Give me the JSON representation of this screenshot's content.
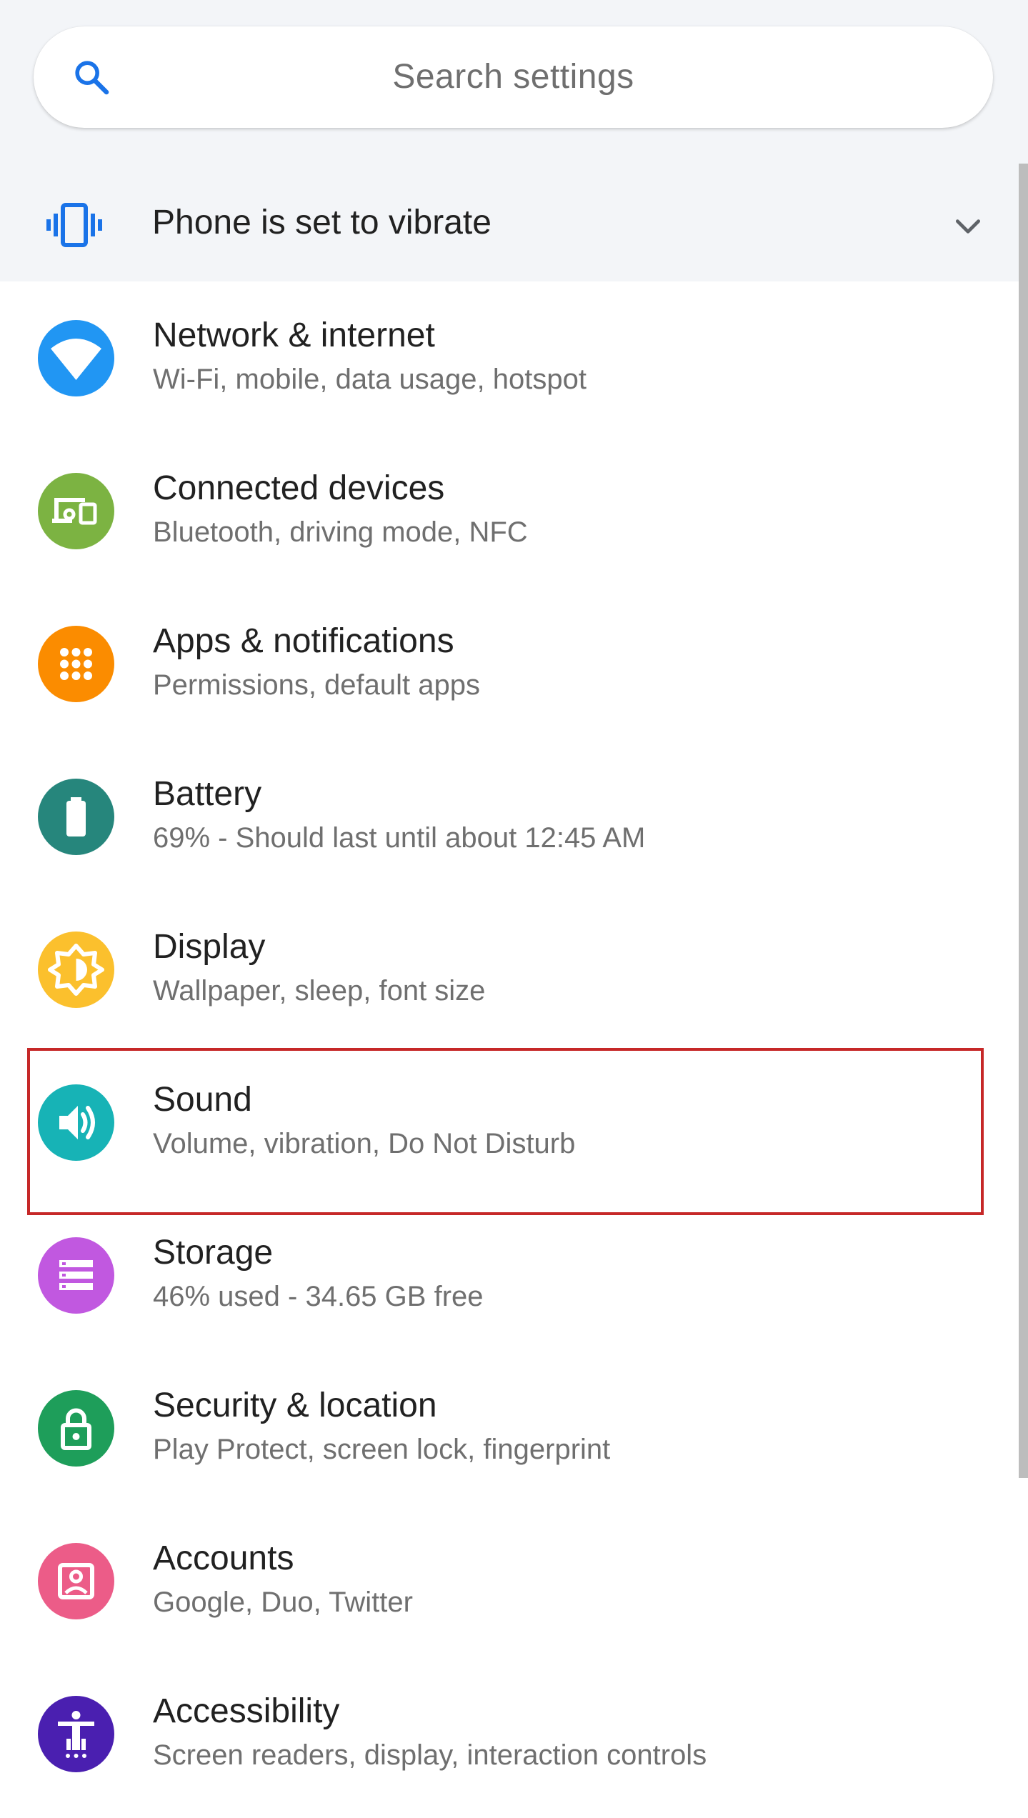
{
  "search": {
    "placeholder": "Search settings",
    "icon": "search-icon"
  },
  "status": {
    "text": "Phone is set to vibrate",
    "icon": "vibrate-icon",
    "expand_icon": "chevron-down-icon"
  },
  "colors": {
    "accent": "#1a73e8",
    "highlight_border": "#c62828"
  },
  "items": [
    {
      "title": "Network & internet",
      "subtitle": "Wi-Fi, mobile, data usage, hotspot",
      "icon": "wifi-icon",
      "color": "#2196f3"
    },
    {
      "title": "Connected devices",
      "subtitle": "Bluetooth, driving mode, NFC",
      "icon": "devices-icon",
      "color": "#7cb342"
    },
    {
      "title": "Apps & notifications",
      "subtitle": "Permissions, default apps",
      "icon": "apps-grid-icon",
      "color": "#fb8c00"
    },
    {
      "title": "Battery",
      "subtitle": "69% - Should last until about 12:45 AM",
      "icon": "battery-icon",
      "color": "#26867c"
    },
    {
      "title": "Display",
      "subtitle": "Wallpaper, sleep, font size",
      "icon": "brightness-icon",
      "color": "#fbc02d"
    },
    {
      "title": "Sound",
      "subtitle": "Volume, vibration, Do Not Disturb",
      "icon": "speaker-icon",
      "color": "#17b3b6"
    },
    {
      "title": "Storage",
      "subtitle": "46% used - 34.65 GB free",
      "icon": "storage-icon",
      "color": "#c158e0"
    },
    {
      "title": "Security & location",
      "subtitle": "Play Protect, screen lock, fingerprint",
      "icon": "lock-icon",
      "color": "#1e9e5a"
    },
    {
      "title": "Accounts",
      "subtitle": "Google, Duo, Twitter",
      "icon": "account-icon",
      "color": "#ec5c88"
    },
    {
      "title": "Accessibility",
      "subtitle": "Screen readers, display, interaction controls",
      "icon": "accessibility-icon",
      "color": "#4a1fb0"
    }
  ]
}
